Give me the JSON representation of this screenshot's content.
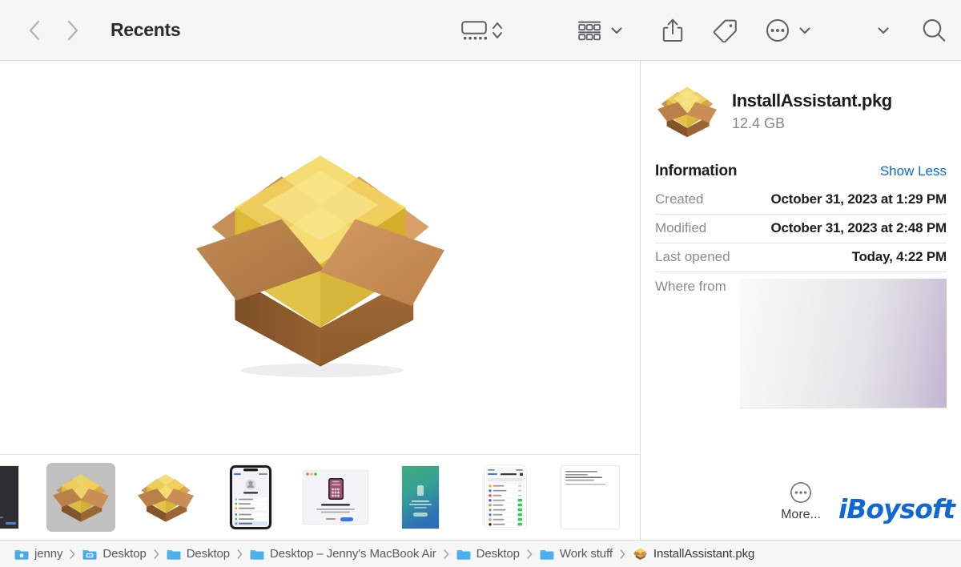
{
  "window": {
    "title": "Recents"
  },
  "toolbar": {
    "back_icon": "chevron-left-icon",
    "forward_icon": "chevron-right-icon",
    "view_gallery_icon": "gallery-view-icon",
    "view_stepper_icon": "up-down-chevron-icon",
    "group_icon": "group-items-icon",
    "group_chevron_icon": "chevron-down-icon",
    "share_icon": "share-icon",
    "tag_icon": "tag-icon",
    "more_icon": "ellipsis-circle-icon",
    "more_chevron_icon": "chevron-down-icon",
    "overflow_chevron_icon": "chevron-down-icon",
    "search_icon": "search-icon"
  },
  "preview": {
    "icon": "package-pkg-icon",
    "filmstrip": [
      {
        "name": "thumbnail-dark-screenshot",
        "kind": "dark",
        "selected": false
      },
      {
        "name": "thumbnail-installassistant-pkg",
        "kind": "pkg",
        "selected": true
      },
      {
        "name": "thumbnail-installassistant-pkg-2",
        "kind": "pkg",
        "selected": false
      },
      {
        "name": "thumbnail-iphone-settings",
        "kind": "phone",
        "selected": false
      },
      {
        "name": "thumbnail-unable-to-connect-dialog",
        "kind": "window",
        "selected": false
      },
      {
        "name": "thumbnail-green-gradient-screen",
        "kind": "gradient",
        "selected": false
      },
      {
        "name": "thumbnail-iphone-app-list",
        "kind": "phone-list",
        "selected": false
      },
      {
        "name": "thumbnail-text-document",
        "kind": "doc",
        "selected": false
      },
      {
        "name": "thumbnail-text-document-2",
        "kind": "doc",
        "selected": false
      }
    ]
  },
  "info": {
    "file_name": "InstallAssistant.pkg",
    "file_size": "12.4 GB",
    "icon": "package-pkg-icon",
    "section_title": "Information",
    "show_less_label": "Show Less",
    "rows": [
      {
        "label": "Created",
        "value": "October 31, 2023 at 1:29 PM"
      },
      {
        "label": "Modified",
        "value": "October 31, 2023 at 2:48 PM"
      },
      {
        "label": "Last opened",
        "value": "Today, 4:22 PM"
      }
    ],
    "where_from_label": "Where from",
    "more_label": "More...",
    "more_icon": "ellipsis-circle-icon"
  },
  "pathbar": {
    "separator": "›",
    "crumbs": [
      {
        "label": "jenny",
        "icon": "home-folder-icon"
      },
      {
        "label": "Desktop",
        "icon": "desktop-folder-icon"
      },
      {
        "label": "Desktop",
        "icon": "folder-icon"
      },
      {
        "label": "Desktop – Jenny's MacBook Air",
        "icon": "folder-icon"
      },
      {
        "label": "Desktop",
        "icon": "folder-icon"
      },
      {
        "label": "Work stuff",
        "icon": "folder-icon"
      },
      {
        "label": "InstallAssistant.pkg",
        "icon": "package-pkg-icon"
      }
    ]
  },
  "watermark": {
    "text": "iBoysoft",
    "color": "#1268d3"
  },
  "colors": {
    "accent_link": "#0a69d8",
    "toolbar_bg": "#f6f6f6",
    "selected_thumb_bg": "#c0c0c0",
    "box_brown": "#a9703c",
    "box_yellow": "#e8c53a"
  }
}
